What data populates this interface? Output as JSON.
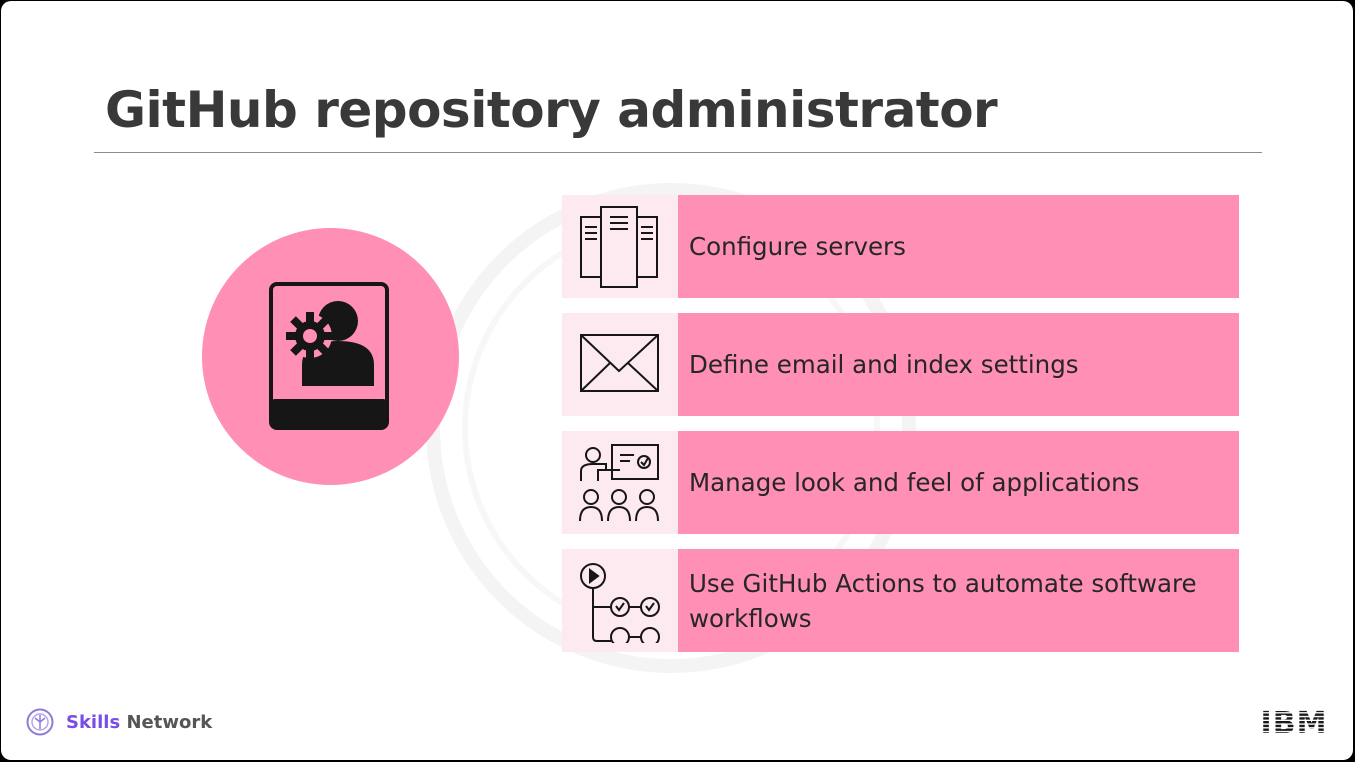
{
  "slide": {
    "title": "GitHub repository administrator"
  },
  "hero": {
    "icon": "admin-user-gear-icon",
    "color": "#ff8fb4"
  },
  "items": [
    {
      "icon": "servers-icon",
      "label": "Configure servers"
    },
    {
      "icon": "envelope-icon",
      "label": "Define email and index settings"
    },
    {
      "icon": "presentation-audience-icon",
      "label": "Manage look and feel of applications"
    },
    {
      "icon": "workflow-icon",
      "label": "Use GitHub Actions to automate software workflows"
    }
  ],
  "footer": {
    "brand_skills": "Skills",
    "brand_network": "Network",
    "brand_icon": "skills-network-logo-icon",
    "ibm_logo": "IBM"
  },
  "colors": {
    "accent_pink": "#ff8fb4",
    "icon_bg": "#fde9f0",
    "title": "#393939",
    "brand_purple": "#7a4de8"
  }
}
